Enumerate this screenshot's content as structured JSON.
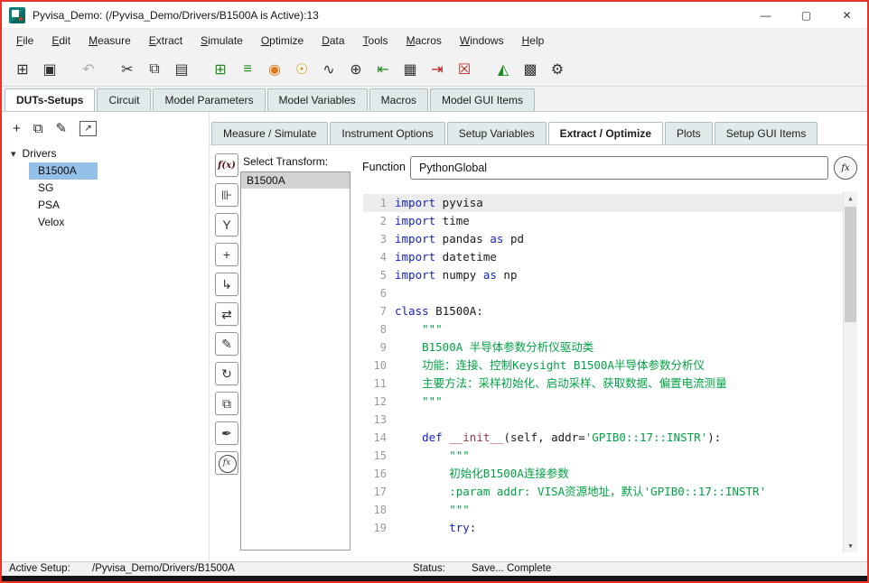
{
  "window": {
    "title": "Pyvisa_Demo: (/Pyvisa_Demo/Drivers/B1500A is Active):13",
    "controls": {
      "minimize": "—",
      "maximize": "▢",
      "close": "✕"
    },
    "border_color": "#e8342c",
    "app_icon": "iccap-logo"
  },
  "menu": {
    "items": [
      "File",
      "Edit",
      "Measure",
      "Extract",
      "Simulate",
      "Optimize",
      "Data",
      "Tools",
      "Macros",
      "Windows",
      "Help"
    ]
  },
  "toolbar": {
    "icons": [
      {
        "name": "open-examples-icon",
        "glyph": "⊞",
        "color": "#333333"
      },
      {
        "name": "save-icon",
        "glyph": "▣",
        "color": "#333333"
      },
      {
        "name": "sep"
      },
      {
        "name": "undo-icon",
        "glyph": "↶",
        "color": "#b0b0b0"
      },
      {
        "name": "sep"
      },
      {
        "name": "cut-icon",
        "glyph": "✂",
        "color": "#333333"
      },
      {
        "name": "copy-icon",
        "glyph": "⧉",
        "color": "#333333"
      },
      {
        "name": "paste-icon",
        "glyph": "▤",
        "color": "#333333"
      },
      {
        "name": "sep"
      },
      {
        "name": "display-plot-icon",
        "glyph": "⊞",
        "color": "#1f8a1f"
      },
      {
        "name": "display-list-icon",
        "glyph": "≡",
        "color": "#1f8a1f"
      },
      {
        "name": "tune-fast-icon",
        "glyph": "◉",
        "color": "#e07818"
      },
      {
        "name": "simulate-icon",
        "glyph": "☉",
        "color": "#c8a200"
      },
      {
        "name": "optimize-icon",
        "glyph": "∿",
        "color": "#333333"
      },
      {
        "name": "gui-globe-icon",
        "glyph": "⊕",
        "color": "#333333"
      },
      {
        "name": "import-data-icon",
        "glyph": "⇤",
        "color": "#1f8a1f"
      },
      {
        "name": "windows-grid-icon",
        "glyph": "▦",
        "color": "#333333"
      },
      {
        "name": "export-data-icon",
        "glyph": "⇥",
        "color": "#b42020"
      },
      {
        "name": "clear-table-icon",
        "glyph": "☒",
        "color": "#b42020"
      },
      {
        "name": "sep"
      },
      {
        "name": "plots-icon",
        "glyph": "◭",
        "color": "#1f8a1f"
      },
      {
        "name": "gui-items-icon",
        "glyph": "▩",
        "color": "#333333"
      },
      {
        "name": "settings-icon",
        "glyph": "⚙",
        "color": "#333333"
      }
    ]
  },
  "main_tabs": {
    "active": "DUTs-Setups",
    "items": [
      "DUTs-Setups",
      "Circuit",
      "Model Parameters",
      "Model Variables",
      "Macros",
      "Model GUI Items"
    ]
  },
  "dut_toolbar": {
    "icons": [
      {
        "name": "add-dut-icon",
        "glyph": "+",
        "boxed": false
      },
      {
        "name": "duplicate-dut-icon",
        "glyph": "⧉",
        "boxed": false
      },
      {
        "name": "edit-dut-icon",
        "glyph": "✎",
        "boxed": false
      },
      {
        "name": "open-window-icon",
        "glyph": "↗",
        "boxed": true
      }
    ]
  },
  "tree": {
    "expander": "▾",
    "root": "Drivers",
    "selected": "B1500A",
    "items": [
      "B1500A",
      "SG",
      "PSA",
      "Velox"
    ]
  },
  "setup_tabs": {
    "active": "Extract / Optimize",
    "items": [
      "Measure / Simulate",
      "Instrument Options",
      "Setup Variables",
      "Extract / Optimize",
      "Plots",
      "Setup GUI Items"
    ]
  },
  "transform_toolbar": {
    "icons": [
      {
        "name": "new-transform-icon",
        "glyph": "f(x)",
        "style": "fxtext"
      },
      {
        "name": "instrument-transform-icon",
        "glyph": "⊪",
        "style": ""
      },
      {
        "name": "wye-transform-icon",
        "glyph": "Y",
        "style": ""
      },
      {
        "name": "add-transform-icon",
        "glyph": "+",
        "style": ""
      },
      {
        "name": "page-arrow-icon",
        "glyph": "↳",
        "style": ""
      },
      {
        "name": "swap-windows-icon",
        "glyph": "⇄",
        "style": ""
      },
      {
        "name": "edit-page-icon",
        "glyph": "✎",
        "style": ""
      },
      {
        "name": "refresh-page-icon",
        "glyph": "↻",
        "style": ""
      },
      {
        "name": "copy-pages-icon",
        "glyph": "⧉",
        "style": ""
      },
      {
        "name": "fill-icon",
        "glyph": "✒",
        "style": ""
      },
      {
        "name": "fx-circle-icon",
        "glyph": "fx",
        "style": "circle"
      }
    ]
  },
  "transform": {
    "label": "Select Transform:",
    "selected": "B1500A",
    "items": [
      "B1500A"
    ]
  },
  "function": {
    "label": "Function",
    "value": "PythonGlobal",
    "button": "fx"
  },
  "scrollbar": {
    "up": "▲",
    "down": "▼"
  },
  "code": {
    "lines": [
      {
        "n": 1,
        "current": true,
        "seg": [
          [
            "kw",
            "import"
          ],
          [
            "pl",
            " pyvisa"
          ]
        ]
      },
      {
        "n": 2,
        "seg": [
          [
            "kw",
            "import"
          ],
          [
            "pl",
            " time"
          ]
        ]
      },
      {
        "n": 3,
        "seg": [
          [
            "kw",
            "import"
          ],
          [
            "pl",
            " pandas "
          ],
          [
            "kw",
            "as"
          ],
          [
            "pl",
            " pd"
          ]
        ]
      },
      {
        "n": 4,
        "seg": [
          [
            "kw",
            "import"
          ],
          [
            "pl",
            " datetime"
          ]
        ]
      },
      {
        "n": 5,
        "seg": [
          [
            "kw",
            "import"
          ],
          [
            "pl",
            " numpy "
          ],
          [
            "kw",
            "as"
          ],
          [
            "pl",
            " np"
          ]
        ]
      },
      {
        "n": 6,
        "seg": []
      },
      {
        "n": 7,
        "seg": [
          [
            "kw",
            "class"
          ],
          [
            "pl",
            " B1500A:"
          ]
        ]
      },
      {
        "n": 8,
        "seg": [
          [
            "str",
            "    \"\"\""
          ]
        ]
      },
      {
        "n": 9,
        "seg": [
          [
            "str",
            "    B1500A 半导体参数分析仪驱动类"
          ]
        ]
      },
      {
        "n": 10,
        "seg": [
          [
            "str",
            "    功能：连接、控制Keysight B1500A半导体参数分析仪"
          ]
        ]
      },
      {
        "n": 11,
        "seg": [
          [
            "str",
            "    主要方法：采样初始化、启动采样、获取数据、偏置电流测量"
          ]
        ]
      },
      {
        "n": 12,
        "seg": [
          [
            "str",
            "    \"\"\""
          ]
        ]
      },
      {
        "n": 13,
        "seg": []
      },
      {
        "n": 14,
        "seg": [
          [
            "pl",
            "    "
          ],
          [
            "kw",
            "def"
          ],
          [
            "pl",
            " "
          ],
          [
            "fn",
            "__init__"
          ],
          [
            "pl",
            "(self, addr="
          ],
          [
            "str",
            "'GPIB0::17::INSTR'"
          ],
          [
            "pl",
            "):"
          ]
        ]
      },
      {
        "n": 15,
        "seg": [
          [
            "str",
            "        \"\"\""
          ]
        ]
      },
      {
        "n": 16,
        "seg": [
          [
            "str",
            "        初始化B1500A连接参数"
          ]
        ]
      },
      {
        "n": 17,
        "seg": [
          [
            "str",
            "        :param addr: VISA资源地址，默认'GPIB0::17::INSTR'"
          ]
        ]
      },
      {
        "n": 18,
        "seg": [
          [
            "str",
            "        \"\"\""
          ]
        ]
      },
      {
        "n": 19,
        "seg": [
          [
            "pl",
            "        "
          ],
          [
            "kw",
            "try"
          ],
          [
            "pl",
            ":"
          ]
        ]
      }
    ]
  },
  "statusbar": {
    "active_setup_label": "Active Setup:",
    "active_setup_value": "/Pyvisa_Demo/Drivers/B1500A",
    "status_label": "Status:",
    "status_value": "Save... Complete"
  }
}
